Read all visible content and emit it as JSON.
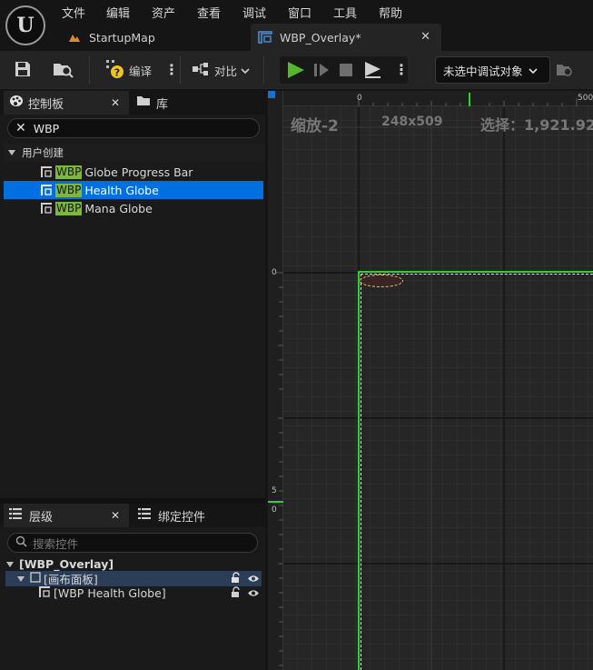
{
  "menu": {
    "items": [
      "文件",
      "编辑",
      "资产",
      "查看",
      "调试",
      "窗口",
      "工具",
      "帮助"
    ]
  },
  "tabs": [
    {
      "label": "StartupMap",
      "icon": "level-icon"
    },
    {
      "label": "WBP_Overlay*",
      "icon": "widget-blueprint-icon",
      "active": true
    }
  ],
  "toolbar": {
    "compile_label": "编译",
    "diff_label": "对比",
    "debug_object_label": "未选中调试对象"
  },
  "palette": {
    "tab_label": "控制板",
    "library_tab_label": "库",
    "search_value": "WBP",
    "category_label": "用户创建",
    "items": [
      {
        "tag": "WBP",
        "name": "Globe Progress Bar"
      },
      {
        "tag": "WBP",
        "name": "Health Globe",
        "selected": true
      },
      {
        "tag": "WBP",
        "name": "Mana Globe"
      }
    ]
  },
  "hierarchy": {
    "tab_label": "层级",
    "bind_tab_label": "绑定控件",
    "search_placeholder": "搜索控件",
    "root_label": "[WBP_Overlay]",
    "canvas_label": "[画布面板]",
    "child_label": "[WBP Health Globe]"
  },
  "canvas": {
    "zoom_label": "缩放-2",
    "size_label": "248x509",
    "selection_label": "选择：1,921.92",
    "ruler_top_ticks": [
      "0",
      "500"
    ],
    "ruler_left_ticks": [
      "0",
      "5",
      "0"
    ]
  },
  "colors": {
    "accent_selection": "#0070e0",
    "wbp_tag": "#7db83a",
    "play_green": "#55b82a",
    "guide_green": "#2fd22f"
  }
}
